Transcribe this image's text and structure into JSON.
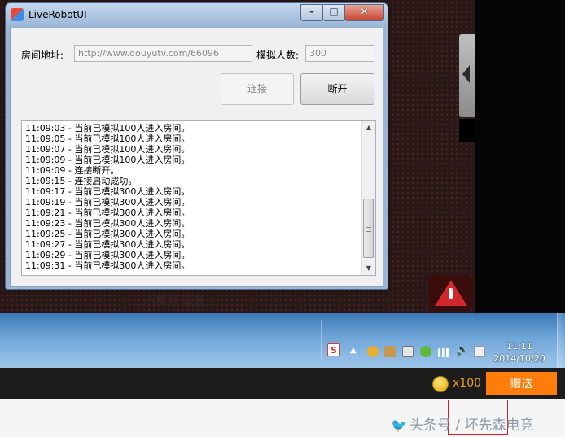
{
  "window": {
    "title": "LiveRobotUI",
    "controls": {
      "minimize": "–",
      "maximize": "□",
      "close": "✕"
    },
    "room_label": "房间地址:",
    "room_value": "http://www.douyutv.com/66096",
    "count_label": "模拟人数:",
    "count_value": "300",
    "connect_label": "连接",
    "disconnect_label": "断开",
    "log_lines": [
      "11:09:03 - 当前已模拟100人进入房间。",
      "11:09:05 - 当前已模拟100人进入房间。",
      "11:09:07 - 当前已模拟100人进入房间。",
      "11:09:09 - 当前已模拟100人进入房间。",
      "11:09:09 - 连接断开。",
      "11:09:15 - 连接启动成功。",
      "11:09:17 - 当前已模拟300人进入房间。",
      "11:09:19 - 当前已模拟300人进入房间。",
      "11:09:21 - 当前已模拟300人进入房间。",
      "11:09:23 - 当前已模拟300人进入房间。",
      "11:09:25 - 当前已模拟300人进入房间。",
      "11:09:27 - 当前已模拟300人进入房间。",
      "11:09:29 - 当前已模拟300人进入房间。",
      "11:09:31 - 当前已模拟300人进入房间。"
    ]
  },
  "stream": {
    "ghost_text": "...小播报消息..."
  },
  "taskbar": {
    "tray_icons": [
      "sogou-ime-icon",
      "show-hidden-icons-icon",
      "qq-icon",
      "folder-icon",
      "clipboard-icon",
      "security-icon",
      "signal-icon",
      "volume-icon",
      "action-center-icon"
    ],
    "ime_glyph": "S",
    "up_glyph": "▲",
    "time": "11:11",
    "date": "2014/10/20"
  },
  "giftbar": {
    "coin_count": "x100",
    "send_gift_label": "赠送"
  },
  "watermark": {
    "text": "头条号 / 坏先森电竞"
  },
  "colors": {
    "gift_orange": "#ff7d0a",
    "coin_gold": "#f0a020",
    "highlight_red": "#d0202a"
  }
}
